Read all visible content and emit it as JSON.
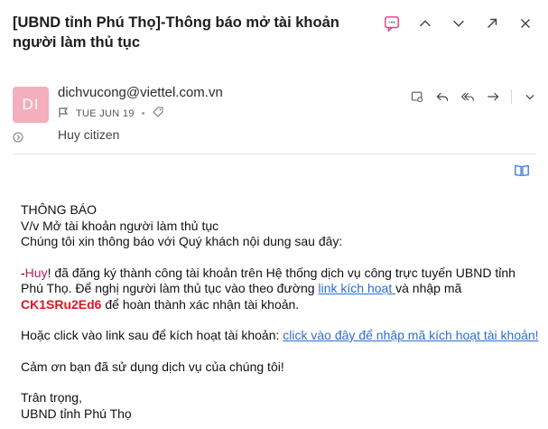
{
  "email": {
    "subject": "[UBND tỉnh Phú Thọ]-Thông báo mở tài khoản người làm thủ tục",
    "sender": "dichvucong@viettel.com.vn",
    "avatar_initials": "DI",
    "avatar_color": "#f5aebb",
    "date": "TUE JUN 19",
    "recipient": "Huy citizen"
  },
  "top_actions": [
    "translate-icon",
    "chevron-up-icon",
    "chevron-down-icon",
    "popout-icon",
    "close-icon"
  ],
  "message_actions": [
    "view-icon",
    "reply-icon",
    "reply-all-icon",
    "forward-icon",
    "more-chevron-icon"
  ],
  "body": {
    "heading": "THÔNG BÁO",
    "regarding": "V/v Mở tài khoản người làm thủ tục",
    "intro": "Chúng tôi xin thông báo với Quý khách nội dung sau đây:",
    "p1_prefix": " -",
    "p1_name": "Huy",
    "p1_text": "! đã đăng ký thành công tài khoản trên Hệ thống dịch vụ công trực tuyến UBND tỉnh Phú Thọ. Để nghị người làm thủ tục vào theo đường ",
    "p1_link": "link kích hoạt ",
    "p1_text2": "và nhập mã  ",
    "p1_code": "CK1SRu2Ed6",
    "p1_text3": "  để hoàn thành xác nhận tài khoản.",
    "p2_text": "Hoặc click vào link sau để kích hoạt tài khoản: ",
    "p2_link": "click vào đây để nhập mã kích hoạt tài khoản!",
    "thanks": "Cảm ơn bạn đã sử dụng dịch vụ của chúng tôi!",
    "closing": "Trân trọng,",
    "signature": "UBND tỉnh Phú Thọ"
  },
  "colors": {
    "link": "#2a6fd4",
    "code": "#e0141e",
    "name_highlight": "#c2185b",
    "accent": "#3b7ddd"
  }
}
